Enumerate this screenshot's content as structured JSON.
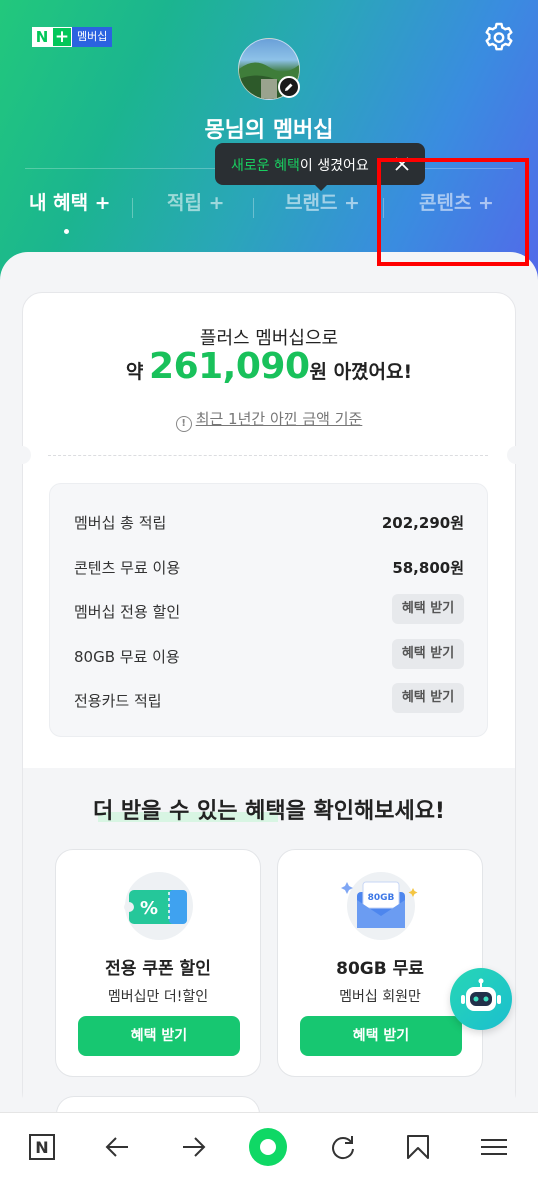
{
  "header": {
    "logo_n": "N",
    "logo_plus": "+",
    "logo_text": "멤버십",
    "title": "몽님의 멤버십"
  },
  "tooltip": {
    "highlight": "새로운 혜택",
    "rest": "이 생겼어요"
  },
  "tabs": [
    {
      "label": "내 혜택 +",
      "active": true
    },
    {
      "label": "적립 +"
    },
    {
      "label": "브랜드 +"
    },
    {
      "label": "콘텐츠 +"
    }
  ],
  "savings": {
    "line1": "플러스 멤버십으로",
    "prefix": "약",
    "amount": "261,090",
    "suffix": "원 아꼈어요!",
    "info": "최근 1년간 아낀 금액 기준"
  },
  "benefit_rows": [
    {
      "label": "멤버십 총 적립",
      "value": "202,290원"
    },
    {
      "label": "콘텐츠 무료 이용",
      "value": "58,800원"
    },
    {
      "label": "멤버십 전용 할인",
      "action": "혜택 받기"
    },
    {
      "label": "80GB 무료 이용",
      "action": "혜택 받기"
    },
    {
      "label": "전용카드 적립",
      "action": "혜택 받기"
    }
  ],
  "more": {
    "title": "더 받을 수 있는 혜택을 확인해보세요!",
    "cards": [
      {
        "title": "전용 쿠폰 할인",
        "subtitle": "멤버십만 더!할인",
        "button": "혜택 받기",
        "icon_text": "%"
      },
      {
        "title": "80GB 무료",
        "subtitle": "멤버십 회원만",
        "button": "혜택 받기",
        "icon_text": "80GB"
      }
    ]
  },
  "navbar": {
    "items": [
      "naver-home-icon",
      "back-arrow-icon",
      "forward-arrow-icon",
      "green-dot-icon",
      "refresh-icon",
      "bookmark-icon",
      "menu-icon"
    ],
    "home_letter": "N"
  },
  "colors": {
    "accent": "#19c15b",
    "button": "#17c771",
    "highlight_box": "#ff0000"
  }
}
